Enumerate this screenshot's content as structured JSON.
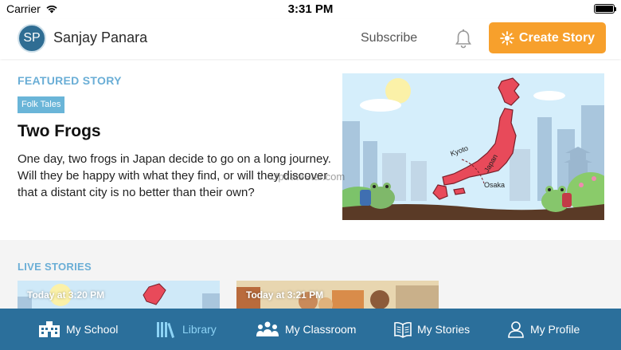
{
  "status_bar": {
    "carrier": "Carrier",
    "time": "3:31 PM"
  },
  "header": {
    "avatar_initials": "SP",
    "user_name": "Sanjay Panara",
    "subscribe_label": "Subscribe",
    "create_story_label": "Create Story"
  },
  "featured": {
    "section_label": "FEATURED STORY",
    "tag": "Folk Tales",
    "title": "Two Frogs",
    "description": "One day, two frogs in Japan decide to go on a long journey. Will they be happy with what they find, or will they discover that a distant city is no better than their own?",
    "map_labels": {
      "kyoto": "Kyoto",
      "japan": "Japan",
      "osaka": "Osaka"
    },
    "watermark": "UpdateStar.com"
  },
  "live": {
    "section_label": "LIVE STORIES",
    "cards": [
      {
        "time": "Today at 3:20 PM"
      },
      {
        "time": "Today at 3:21 PM"
      }
    ]
  },
  "tabs": [
    {
      "label": "My School",
      "icon": "school-icon",
      "active": false
    },
    {
      "label": "Library",
      "icon": "library-icon",
      "active": true
    },
    {
      "label": "My Classroom",
      "icon": "classroom-icon",
      "active": false
    },
    {
      "label": "My Stories",
      "icon": "book-icon",
      "active": false
    },
    {
      "label": "My Profile",
      "icon": "profile-icon",
      "active": false
    }
  ],
  "colors": {
    "accent_orange": "#f7a02c",
    "tab_bar_blue": "#2b6f9b",
    "active_tab": "#8dd3f5",
    "section_label_blue": "#6aaed6",
    "map_red": "#e84a5a"
  }
}
